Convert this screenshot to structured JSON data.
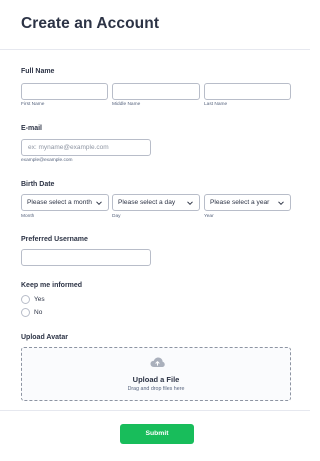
{
  "form": {
    "title": "Create an Account",
    "full_name": {
      "label": "Full Name",
      "first_sublabel": "First Name",
      "middle_sublabel": "Middle Name",
      "last_sublabel": "Last Name"
    },
    "email": {
      "label": "E-mail",
      "placeholder": "ex: myname@example.com",
      "sublabel": "example@example.com"
    },
    "birth_date": {
      "label": "Birth Date",
      "month_value": "Please select a month",
      "day_value": "Please select a day",
      "year_value": "Please select a year",
      "month_sublabel": "Month",
      "day_sublabel": "Day",
      "year_sublabel": "Year"
    },
    "username": {
      "label": "Preferred Username"
    },
    "keep_informed": {
      "label": "Keep me informed",
      "options": [
        "Yes",
        "No"
      ]
    },
    "avatar": {
      "label": "Upload Avatar",
      "upload_title": "Upload a File",
      "upload_hint": "Drag and drop files here"
    },
    "submit_label": "Submit"
  },
  "colors": {
    "accent": "#18bd5b",
    "text": "#2c3345",
    "border": "#b8bdc9",
    "cloud_icon": "#aab0bc"
  },
  "icons": {
    "select_chevron": "chevron-down-icon",
    "upload": "cloud-upload-icon"
  }
}
